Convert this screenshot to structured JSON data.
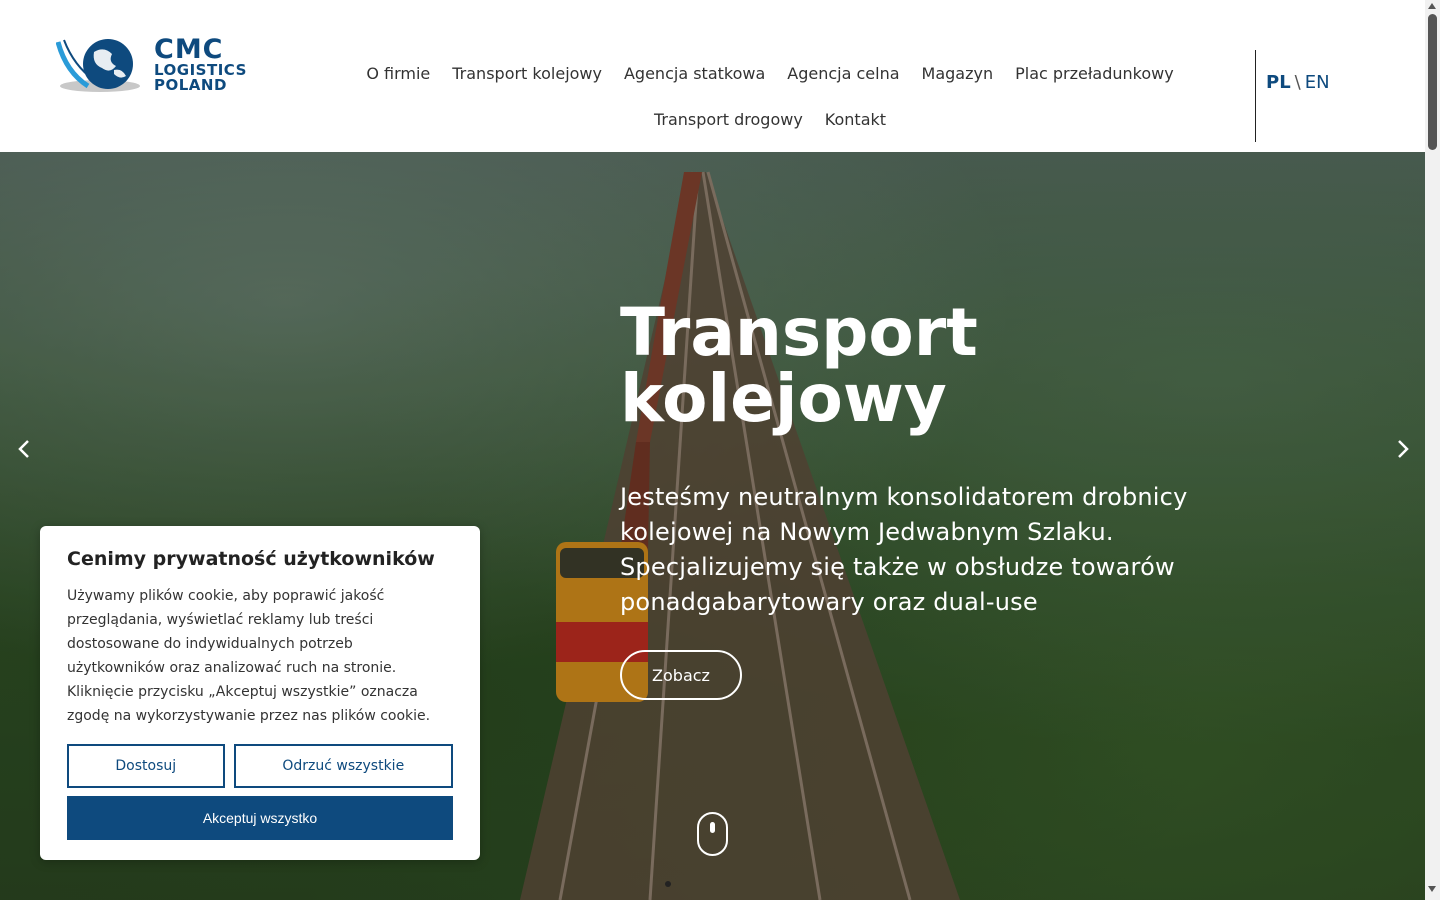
{
  "logo": {
    "line1": "CMC",
    "line2": "LOGISTICS",
    "line3": "POLAND",
    "color": "#0e4a7e"
  },
  "nav": {
    "row1": [
      "O firmie",
      "Transport kolejowy",
      "Agencja statkowa",
      "Agencja celna",
      "Magazyn",
      "Plac przeładunkowy"
    ],
    "row2": [
      "Transport drogowy",
      "Kontakt"
    ]
  },
  "lang": {
    "pl": "PL",
    "separator": "\\",
    "en": "EN"
  },
  "hero": {
    "title_line1": "Transport",
    "title_line2": "kolejowy",
    "text": "Jesteśmy neutralnym konsolidatorem drobnicy kolejowej na Nowym Jedwabnym Szlaku. Specjalizujemy się także w obsłudze towarów ponadgabarytowary oraz dual-use",
    "button": "Zobacz",
    "prev_icon": "chevron-left-icon",
    "next_icon": "chevron-right-icon"
  },
  "cookie": {
    "title": "Cenimy prywatność użytkowników",
    "text": "Używamy plików cookie, aby poprawić jakość przeglądania, wyświetlać reklamy lub treści dostosowane do indywidualnych potrzeb użytkowników oraz analizować ruch na stronie. Kliknięcie przycisku „Akceptuj wszystkie” oznacza zgodę na wykorzystywanie przez nas plików cookie.",
    "customize": "Dostosuj",
    "reject": "Odrzuć wszystkie",
    "accept": "Akceptuj wszystko"
  }
}
